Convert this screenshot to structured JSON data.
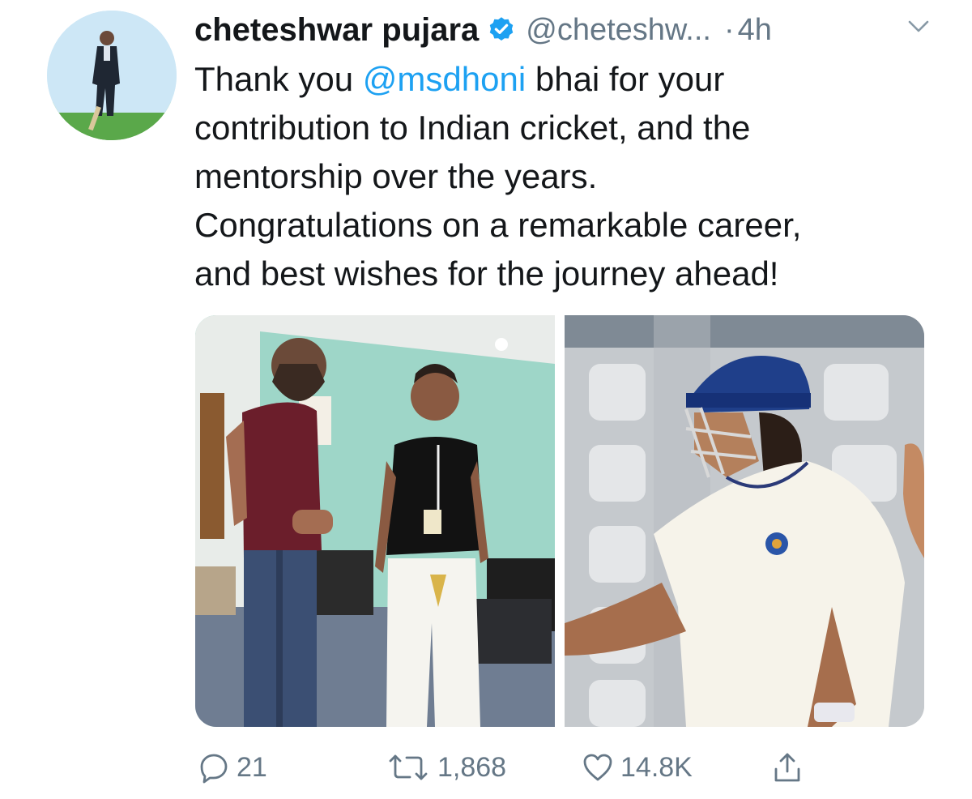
{
  "tweet": {
    "author_name": "cheteshwar pujara",
    "handle": "@cheteshw...",
    "separator": "·",
    "time": "4h",
    "text_before": "Thank you ",
    "mention": "@msdhoni",
    "text_line1_after": " bhai for your",
    "text_line2": "contribution to Indian cricket, and the",
    "text_line3": "mentorship over the years.",
    "text_line4": "Congratulations on a remarkable career,",
    "text_line5": "and best wishes for the journey ahead!"
  },
  "actions": {
    "replies": "21",
    "retweets": "1,868",
    "likes": "14.8K"
  },
  "colors": {
    "link": "#1da1f2",
    "verified": "#1da1f2",
    "secondary": "#657786"
  },
  "icons": [
    "avatar",
    "verified-badge-icon",
    "chevron-down-icon",
    "reply-icon",
    "retweet-icon",
    "like-icon",
    "share-icon"
  ]
}
